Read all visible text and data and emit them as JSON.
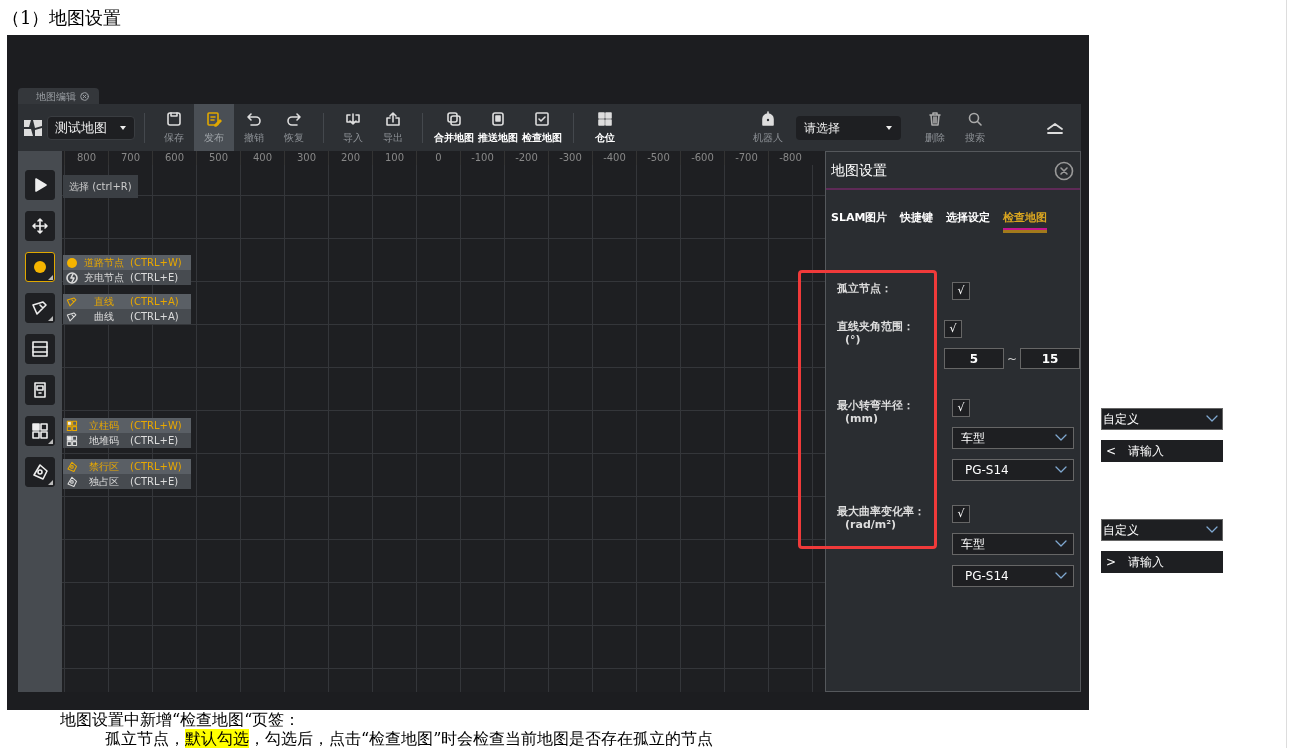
{
  "heading": "（1）地图设置",
  "app": {
    "tab": {
      "label": "地图编辑"
    },
    "map_select": {
      "value": "测试地图"
    },
    "toolbar": [
      {
        "kind": "separator"
      },
      {
        "kind": "button",
        "label": "保存",
        "selected": false
      },
      {
        "kind": "button",
        "label": "发布",
        "selected": true
      },
      {
        "kind": "button",
        "label": "撤销",
        "selected": false
      },
      {
        "kind": "button",
        "label": "恢复",
        "selected": false
      },
      {
        "kind": "separator"
      },
      {
        "kind": "button",
        "label": "导入",
        "selected": false
      },
      {
        "kind": "button",
        "label": "导出",
        "selected": false
      },
      {
        "kind": "separator"
      },
      {
        "kind": "action",
        "label": "合并地图",
        "selected": false
      },
      {
        "kind": "action",
        "label": "推送地图",
        "selected": false
      },
      {
        "kind": "action",
        "label": "检查地图",
        "selected": false
      },
      {
        "kind": "separator"
      },
      {
        "kind": "action",
        "label": "仓位",
        "selected": false
      }
    ],
    "robot_button": {
      "label": "机器人"
    },
    "robot_select": {
      "value": "请选择"
    },
    "right_buttons": [
      {
        "label": "删除"
      },
      {
        "label": "搜索"
      }
    ],
    "ruler": [
      "800",
      "700",
      "600",
      "500",
      "400",
      "300",
      "200",
      "100",
      "0",
      "-100",
      "-200",
      "-300",
      "-400",
      "-500",
      "-600",
      "-700",
      "-800"
    ],
    "tools": [
      {
        "selected": false,
        "tooltip": "选择 (ctrl+R)"
      },
      {
        "selected": false
      },
      {
        "selected": true,
        "menu": [
          {
            "label": "道路节点",
            "shortcut": "(CTRL+W)",
            "selected": true
          },
          {
            "label": "充电节点",
            "shortcut": "(CTRL+E)",
            "selected": false
          }
        ]
      },
      {
        "selected": false,
        "menu": [
          {
            "label": "直线",
            "shortcut": "(CTRL+A)",
            "selected": true
          },
          {
            "label": "曲线",
            "shortcut": "(CTRL+A)",
            "selected": false
          }
        ]
      },
      {
        "selected": false
      },
      {
        "selected": false
      },
      {
        "selected": false,
        "menu": [
          {
            "label": "立柱码",
            "shortcut": "(CTRL+W)",
            "selected": true
          },
          {
            "label": "地堆码",
            "shortcut": "(CTRL+E)",
            "selected": false
          }
        ]
      },
      {
        "selected": false,
        "menu": [
          {
            "label": "禁行区",
            "shortcut": "(CTRL+W)",
            "selected": true
          },
          {
            "label": "独占区",
            "shortcut": "(CTRL+E)",
            "selected": false
          }
        ]
      }
    ],
    "settings": {
      "title": "地图设置",
      "tabs": [
        {
          "label": "SLAM图片",
          "selected": false
        },
        {
          "label": "快捷键",
          "selected": false
        },
        {
          "label": "选择设定",
          "selected": false
        },
        {
          "label": "检查地图",
          "selected": true
        }
      ],
      "rows": [
        {
          "kind": "check",
          "label": "孤立节点：",
          "checkmark": "√",
          "checked": true
        },
        {
          "kind": "range",
          "label": "直线夹角范围：",
          "unit": "(°)",
          "checkmark": "√",
          "checked": true,
          "from": "5",
          "separator": "~",
          "to": "15"
        },
        {
          "kind": "select",
          "label": "最小转弯半径：",
          "unit": "(mm)",
          "checkmark": "√",
          "checked": true,
          "type_select": "车型",
          "model_select": "PG-S14"
        },
        {
          "kind": "select",
          "label": "最大曲率变化率：",
          "unit": "(rad/m²)",
          "checkmark": "√",
          "checked": true,
          "type_select": "车型",
          "model_select": "PG-S14"
        }
      ]
    }
  },
  "side_fields": [
    {
      "select": "自定义",
      "prefix": "<",
      "placeholder": "请输入"
    },
    {
      "select": "自定义",
      "prefix": ">",
      "placeholder": "请输入"
    }
  ],
  "paragraphs": [
    {
      "segments": [
        {
          "text": "地图设置中新增“检查地图“页签：",
          "highlight": false
        }
      ]
    },
    {
      "segments": [
        {
          "text": "孤立节点，",
          "highlight": false
        },
        {
          "text": "默认勾选",
          "highlight": true
        },
        {
          "text": "，勾选后，点击“检查地图”时会检查当前地图是否存在孤立的节点",
          "highlight": false
        }
      ]
    }
  ]
}
